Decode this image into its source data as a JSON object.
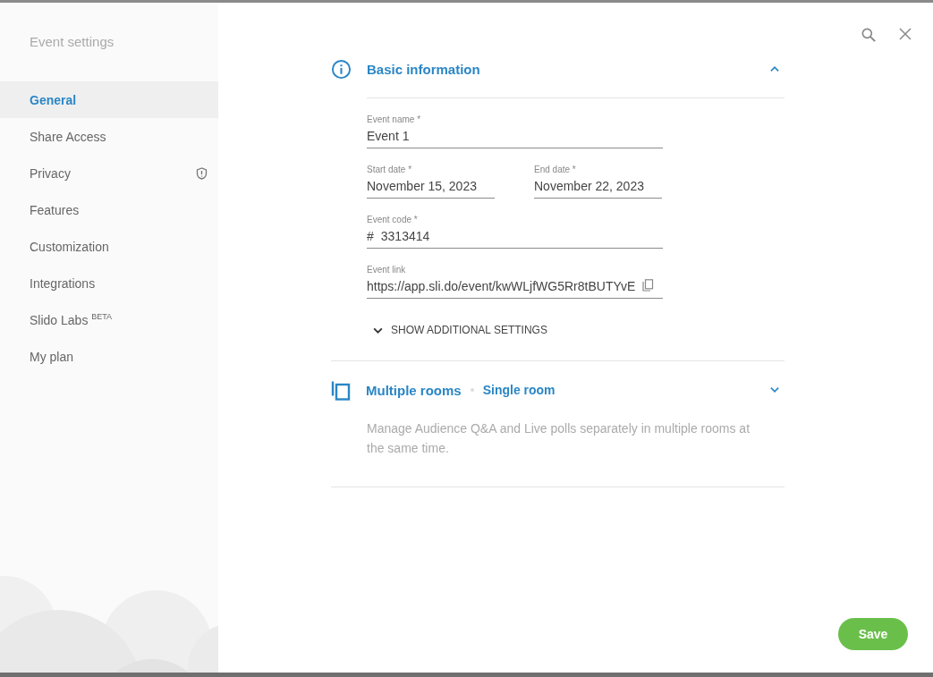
{
  "sidebar": {
    "title": "Event settings",
    "items": [
      {
        "label": "General",
        "selected": true,
        "warning": false
      },
      {
        "label": "Share Access",
        "selected": false,
        "warning": false
      },
      {
        "label": "Privacy",
        "selected": false,
        "warning": true
      },
      {
        "label": "Features",
        "selected": false,
        "warning": false
      },
      {
        "label": "Customization",
        "selected": false,
        "warning": false
      },
      {
        "label": "Integrations",
        "selected": false,
        "warning": false
      },
      {
        "label": "Slido Labs $^{BETA}$",
        "selected": false,
        "warning": false
      },
      {
        "label": "My plan",
        "selected": false,
        "warning": false
      }
    ]
  },
  "basic_information": {
    "title": "Basic information",
    "expanded": true,
    "rows": [
      [
        {
          "label": "Event name *",
          "value": "Event 1",
          "copyable": false
        }
      ],
      [
        {
          "label": "Start date *",
          "value": "November 15, 2023",
          "copyable": false
        },
        {
          "label": "End date *",
          "value": "November 22, 2023",
          "copyable": false
        }
      ],
      [
        {
          "label": "Event code *",
          "prefix": "#",
          "value": "3313414",
          "copyable": false
        }
      ],
      [
        {
          "label": "Event link",
          "value": "https://app.sli.do/event/kwWLjfWG5Rr8tBUTYvE",
          "copyable": true
        }
      ]
    ],
    "more_toggle": "SHOW ADDITIONAL SETTINGS"
  },
  "multiple_rooms": {
    "title": "Multiple rooms",
    "status": "Single room",
    "expanded": false,
    "description": "Manage Audience Q&A and Live polls separately in multiple rooms at the same time."
  },
  "save_button": "Save"
}
